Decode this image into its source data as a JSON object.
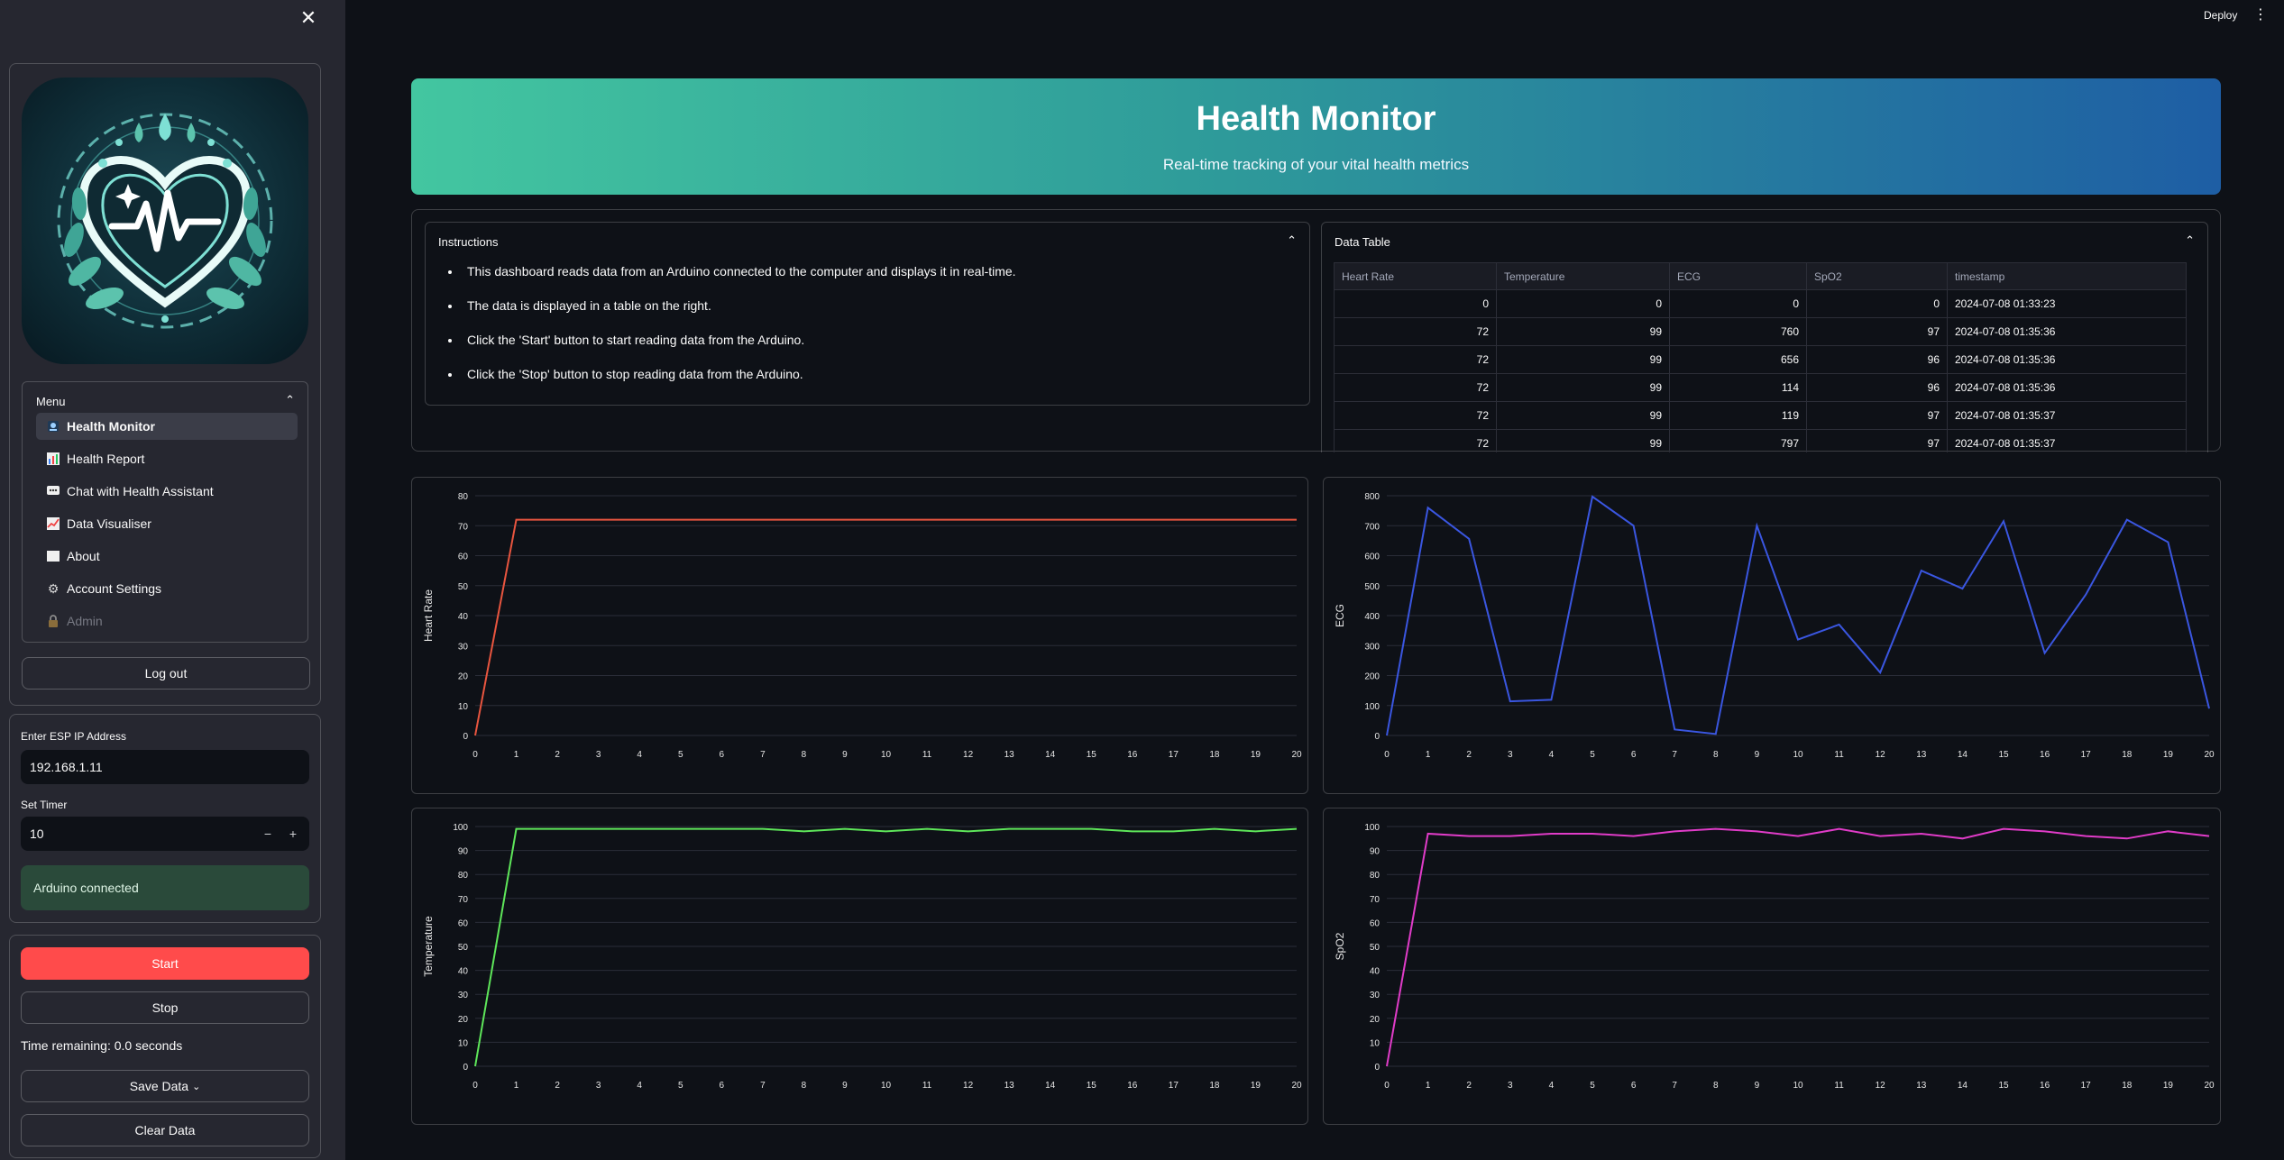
{
  "sidebar": {
    "menu": {
      "title": "Menu",
      "items": [
        {
          "label": "Health Monitor",
          "icon": "health-monitor-icon",
          "active": true
        },
        {
          "label": "Health Report",
          "icon": "bar-chart-icon"
        },
        {
          "label": "Chat with Health Assistant",
          "icon": "chat-icon"
        },
        {
          "label": "Data Visualiser",
          "icon": "line-chart-icon"
        },
        {
          "label": "About",
          "icon": "document-icon"
        },
        {
          "label": "Account Settings",
          "icon": "gear-icon"
        },
        {
          "label": "Admin",
          "icon": "lock-icon",
          "disabled": true
        }
      ]
    },
    "logout_label": "Log out",
    "ip": {
      "label": "Enter ESP IP Address",
      "value": "192.168.1.11"
    },
    "timer": {
      "label": "Set Timer",
      "value": "10",
      "minus": "−",
      "plus": "+"
    },
    "status": "Arduino connected",
    "start_label": "Start",
    "stop_label": "Stop",
    "time_remaining": "Time remaining: 0.0 seconds",
    "save_label": "Save Data",
    "clear_label": "Clear Data"
  },
  "header": {
    "deploy_label": "Deploy"
  },
  "hero": {
    "title": "Health Monitor",
    "subtitle": "Real-time tracking of your vital health metrics"
  },
  "instructions": {
    "title": "Instructions",
    "items": [
      "This dashboard reads data from an Arduino connected to the computer and displays it in real-time.",
      "The data is displayed in a table on the right.",
      "Click the 'Start' button to start reading data from the Arduino.",
      "Click the 'Stop' button to stop reading data from the Arduino."
    ]
  },
  "data_table": {
    "title": "Data Table",
    "columns": [
      "Heart Rate",
      "Temperature",
      "ECG",
      "SpO2",
      "timestamp"
    ],
    "rows": [
      [
        "0",
        "0",
        "0",
        "0",
        "2024-07-08 01:33:23"
      ],
      [
        "72",
        "99",
        "760",
        "97",
        "2024-07-08 01:35:36"
      ],
      [
        "72",
        "99",
        "656",
        "96",
        "2024-07-08 01:35:36"
      ],
      [
        "72",
        "99",
        "114",
        "96",
        "2024-07-08 01:35:36"
      ],
      [
        "72",
        "99",
        "119",
        "97",
        "2024-07-08 01:35:37"
      ],
      [
        "72",
        "99",
        "797",
        "97",
        "2024-07-08 01:35:37"
      ]
    ]
  },
  "colors": {
    "heart_rate": "#e8553f",
    "ecg": "#3a56e0",
    "temperature": "#5ee65a",
    "spo2": "#e03cc8",
    "accent": "#ff4b4b"
  },
  "chart_data": [
    {
      "type": "line",
      "ylabel": "Heart Rate",
      "x": [
        0,
        1,
        2,
        3,
        4,
        5,
        6,
        7,
        8,
        9,
        10,
        11,
        12,
        13,
        14,
        15,
        16,
        17,
        18,
        19,
        20
      ],
      "series": [
        {
          "values": [
            0,
            72,
            72,
            72,
            72,
            72,
            72,
            72,
            72,
            72,
            72,
            72,
            72,
            72,
            72,
            72,
            72,
            72,
            72,
            72,
            72
          ]
        }
      ],
      "xlim": [
        0,
        20
      ],
      "ylim": [
        0,
        80
      ],
      "yticks": [
        0,
        10,
        20,
        30,
        40,
        50,
        60,
        70,
        80
      ],
      "color": "#e8553f"
    },
    {
      "type": "line",
      "ylabel": "ECG",
      "x": [
        0,
        1,
        2,
        3,
        4,
        5,
        6,
        7,
        8,
        9,
        10,
        11,
        12,
        13,
        14,
        15,
        16,
        17,
        18,
        19,
        20
      ],
      "series": [
        {
          "values": [
            0,
            760,
            656,
            114,
            119,
            797,
            700,
            20,
            5,
            700,
            320,
            370,
            210,
            550,
            490,
            715,
            275,
            470,
            720,
            645,
            90
          ]
        }
      ],
      "xlim": [
        0,
        20
      ],
      "ylim": [
        0,
        800
      ],
      "yticks": [
        0,
        100,
        200,
        300,
        400,
        500,
        600,
        700,
        800
      ],
      "color": "#3a56e0"
    },
    {
      "type": "line",
      "ylabel": "Temperature",
      "x": [
        0,
        1,
        2,
        3,
        4,
        5,
        6,
        7,
        8,
        9,
        10,
        11,
        12,
        13,
        14,
        15,
        16,
        17,
        18,
        19,
        20
      ],
      "series": [
        {
          "values": [
            0,
            99,
            99,
            99,
            99,
            99,
            99,
            99,
            98,
            99,
            98,
            99,
            98,
            99,
            99,
            99,
            98,
            98,
            99,
            98,
            99
          ]
        }
      ],
      "xlim": [
        0,
        20
      ],
      "ylim": [
        0,
        100
      ],
      "yticks": [
        0,
        10,
        20,
        30,
        40,
        50,
        60,
        70,
        80,
        90,
        100
      ],
      "color": "#5ee65a"
    },
    {
      "type": "line",
      "ylabel": "SpO2",
      "x": [
        0,
        1,
        2,
        3,
        4,
        5,
        6,
        7,
        8,
        9,
        10,
        11,
        12,
        13,
        14,
        15,
        16,
        17,
        18,
        19,
        20
      ],
      "series": [
        {
          "values": [
            0,
            97,
            96,
            96,
            97,
            97,
            96,
            98,
            99,
            98,
            96,
            99,
            96,
            97,
            95,
            99,
            98,
            96,
            95,
            98,
            96
          ]
        }
      ],
      "xlim": [
        0,
        20
      ],
      "ylim": [
        0,
        100
      ],
      "yticks": [
        0,
        10,
        20,
        30,
        40,
        50,
        60,
        70,
        80,
        90,
        100
      ],
      "color": "#e03cc8"
    }
  ]
}
